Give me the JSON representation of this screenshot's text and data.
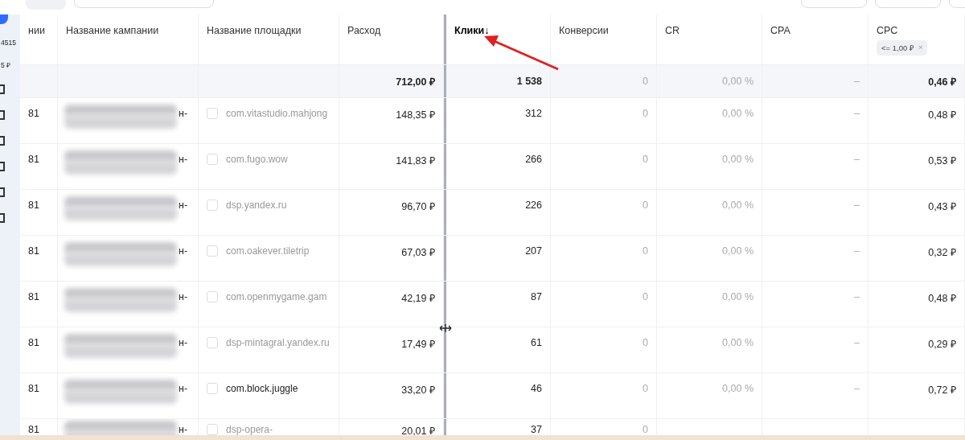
{
  "sidebar": {
    "items": [
      {
        "text": "4515"
      },
      {
        "text": "5 ₽"
      }
    ]
  },
  "table": {
    "columns": [
      {
        "label": "нии"
      },
      {
        "label": "Название кампании"
      },
      {
        "label": "Название площадки"
      },
      {
        "label": "Расход"
      },
      {
        "label": "Клики↓",
        "sorted": true
      },
      {
        "label": "Конверсии"
      },
      {
        "label": "CR"
      },
      {
        "label": "CPA"
      },
      {
        "label": "CPC",
        "filter": {
          "text": "<= 1,00 ₽",
          "close": "×"
        }
      }
    ],
    "totals": {
      "spend": "712,00 ₽",
      "clicks": "1 538",
      "conversions": "0",
      "cr": "0,00 %",
      "cpa": "–",
      "cpc": "0,46 ₽"
    },
    "rows": [
      {
        "id": "81",
        "name_tail": "н-",
        "checked": false,
        "placement": "com.vitastudio.mahjong",
        "muted": true,
        "spend": "148,35 ₽",
        "clicks": "312",
        "conversions": "0",
        "cr": "0,00 %",
        "cpa": "–",
        "cpc": "0,48 ₽"
      },
      {
        "id": "81",
        "name_tail": "н-",
        "checked": false,
        "placement": "com.fugo.wow",
        "muted": true,
        "spend": "141,83 ₽",
        "clicks": "266",
        "conversions": "0",
        "cr": "0,00 %",
        "cpa": "–",
        "cpc": "0,53 ₽"
      },
      {
        "id": "81",
        "name_tail": "н-",
        "checked": false,
        "placement": "dsp.yandex.ru",
        "muted": true,
        "spend": "96,70 ₽",
        "clicks": "226",
        "conversions": "0",
        "cr": "0,00 %",
        "cpa": "–",
        "cpc": "0,43 ₽"
      },
      {
        "id": "81",
        "name_tail": "н-",
        "checked": false,
        "placement": "com.oakever.tiletrip",
        "muted": true,
        "spend": "67,03 ₽",
        "clicks": "207",
        "conversions": "0",
        "cr": "0,00 %",
        "cpa": "–",
        "cpc": "0,32 ₽"
      },
      {
        "id": "81",
        "name_tail": "н-",
        "checked": false,
        "placement": "com.openmygame.gam",
        "muted": true,
        "spend": "42,19 ₽",
        "clicks": "87",
        "conversions": "0",
        "cr": "0,00 %",
        "cpa": "–",
        "cpc": "0,48 ₽"
      },
      {
        "id": "81",
        "name_tail": "н-",
        "checked": false,
        "placement": "dsp-mintagral.yandex.ru",
        "muted": true,
        "spend": "17,49 ₽",
        "clicks": "61",
        "conversions": "0",
        "cr": "0,00 %",
        "cpa": "–",
        "cpc": "0,29 ₽"
      },
      {
        "id": "81",
        "name_tail": "н-",
        "checked": false,
        "placement": "com.block.juggle",
        "muted": false,
        "spend": "33,20 ₽",
        "clicks": "46",
        "conversions": "0",
        "cr": "0,00 %",
        "cpa": "–",
        "cpc": "0,72 ₽"
      },
      {
        "id": "81",
        "name_tail": "н-",
        "checked": false,
        "placement": "dsp-opera-",
        "muted": true,
        "spend": "20,01 ₽",
        "clicks": "37",
        "conversions": "0"
      }
    ]
  }
}
